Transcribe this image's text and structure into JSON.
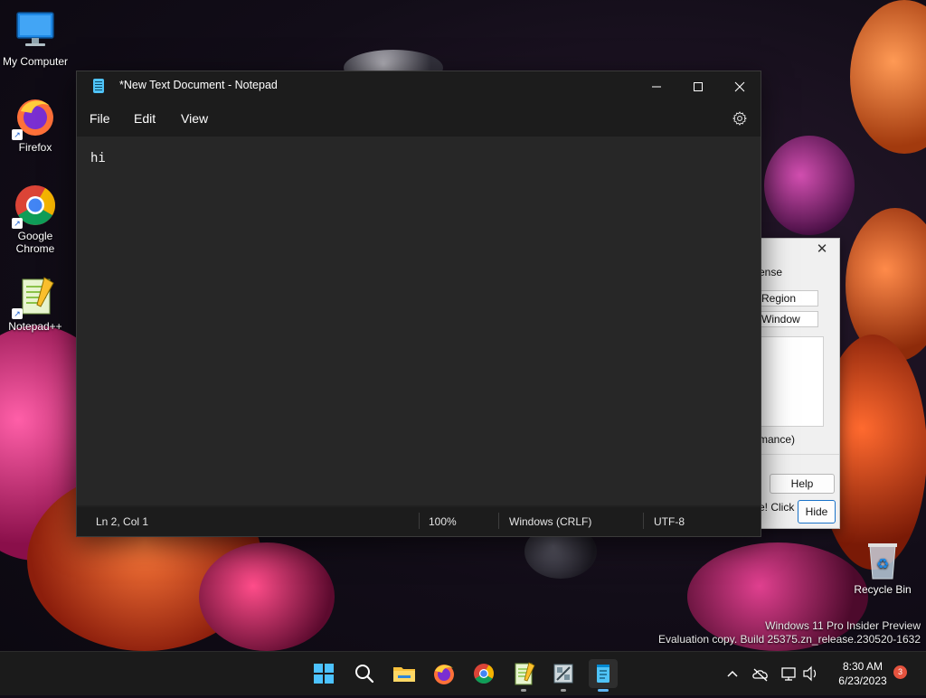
{
  "desktop": {
    "icons": [
      {
        "label": "My Computer"
      },
      {
        "label": "Firefox"
      },
      {
        "label": "Google Chrome"
      },
      {
        "label": "Notepad++"
      },
      {
        "label": "Recycle Bin"
      }
    ],
    "watermark": {
      "line1": "Windows 11 Pro Insider Preview",
      "line2": "Evaluation copy. Build 25375.zn_release.230520-1632"
    }
  },
  "notepad": {
    "title": "*New Text Document - Notepad",
    "menu": {
      "file": "File",
      "edit": "Edit",
      "view": "View"
    },
    "content": "hi",
    "status": {
      "position": "Ln 2, Col 1",
      "zoom": "100%",
      "line_ending": "Windows (CRLF)",
      "encoding": "UTF-8"
    }
  },
  "background_dialog": {
    "label_license": "ense",
    "btn_region": "Region",
    "btn_window": "Window",
    "text_performance": "mance)",
    "btn_help": "Help",
    "text_click": "e! Click",
    "btn_hide": "Hide"
  },
  "taskbar": {
    "time": "8:30 AM",
    "date": "6/23/2023",
    "notification_count": "3"
  },
  "colors": {
    "accent": "#5fb4f0",
    "notepad_bg": "#272727",
    "titlebar": "#1c1c1c"
  }
}
